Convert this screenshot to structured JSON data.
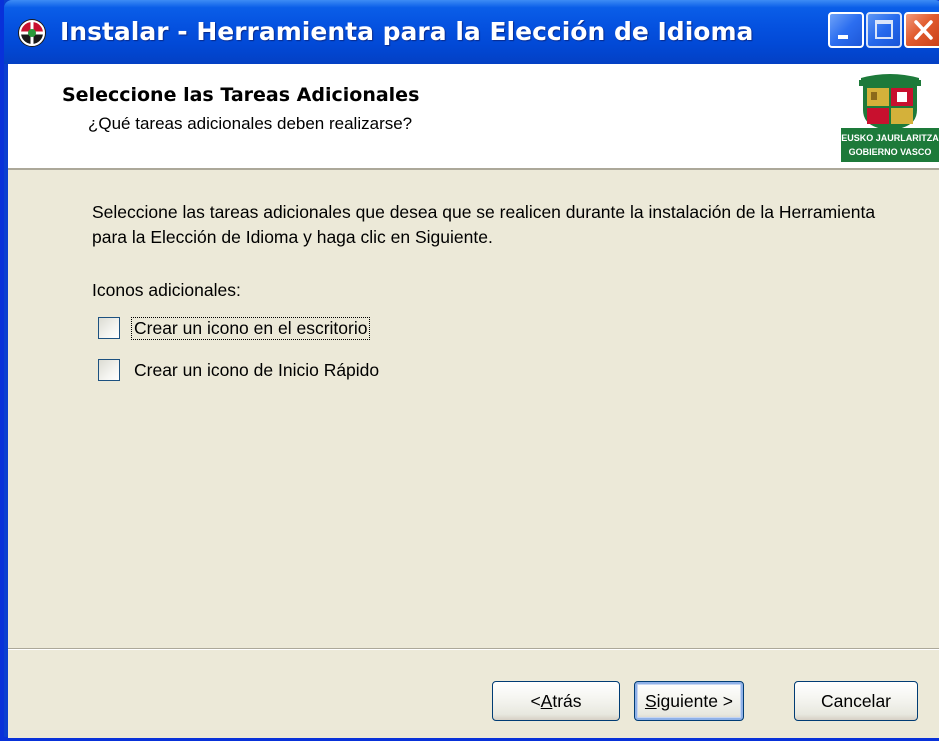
{
  "window": {
    "title": "Instalar - Herramienta para la Elección de Idioma"
  },
  "header": {
    "title": "Seleccione las Tareas Adicionales",
    "subtitle": "¿Qué tareas adicionales deben realizarse?",
    "logo_line1": "EUSKO JAURLARITZA",
    "logo_line2": "GOBIERNO VASCO"
  },
  "main": {
    "description": "Seleccione las tareas adicionales que desea que se realicen durante la instalación de la Herramienta para la Elección de Idioma y haga clic en Siguiente.",
    "section_label": "Iconos adicionales:",
    "options": [
      {
        "label": "Crear un icono en el escritorio",
        "checked": false
      },
      {
        "label": "Crear un icono de Inicio Rápido",
        "checked": false
      }
    ]
  },
  "footer": {
    "back_prefix": "< ",
    "back_hotkey": "A",
    "back_rest": "trás",
    "next_hotkey": "S",
    "next_rest": "iguiente >",
    "cancel_label": "Cancelar"
  },
  "colors": {
    "titlebar": "#0552e0",
    "dialog_bg": "#ece9d8",
    "header_bg": "#ffffff"
  }
}
